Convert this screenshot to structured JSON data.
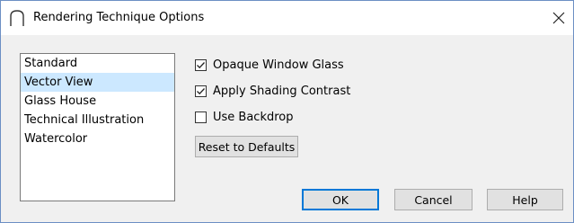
{
  "window": {
    "title": "Rendering Technique Options",
    "close_glyph": "×"
  },
  "technique_list": {
    "items": [
      {
        "label": "Standard",
        "selected": false
      },
      {
        "label": "Vector View",
        "selected": true
      },
      {
        "label": "Glass House",
        "selected": false
      },
      {
        "label": "Technical Illustration",
        "selected": false
      },
      {
        "label": "Watercolor",
        "selected": false
      }
    ]
  },
  "options": {
    "opaque_window_glass": {
      "label": "Opaque Window Glass",
      "checked": true
    },
    "apply_shading_contrast": {
      "label": "Apply Shading Contrast",
      "checked": true
    },
    "use_backdrop": {
      "label": "Use Backdrop",
      "checked": false
    }
  },
  "buttons": {
    "reset": "Reset to Defaults",
    "ok": "OK",
    "cancel": "Cancel",
    "help": "Help"
  },
  "colors": {
    "selection": "#cce8ff",
    "default_button_border": "#0078d7",
    "dialog_border": "#6c8fc4"
  },
  "icons": {
    "app": "arch-icon",
    "close": "close-icon",
    "check": "check-icon"
  }
}
